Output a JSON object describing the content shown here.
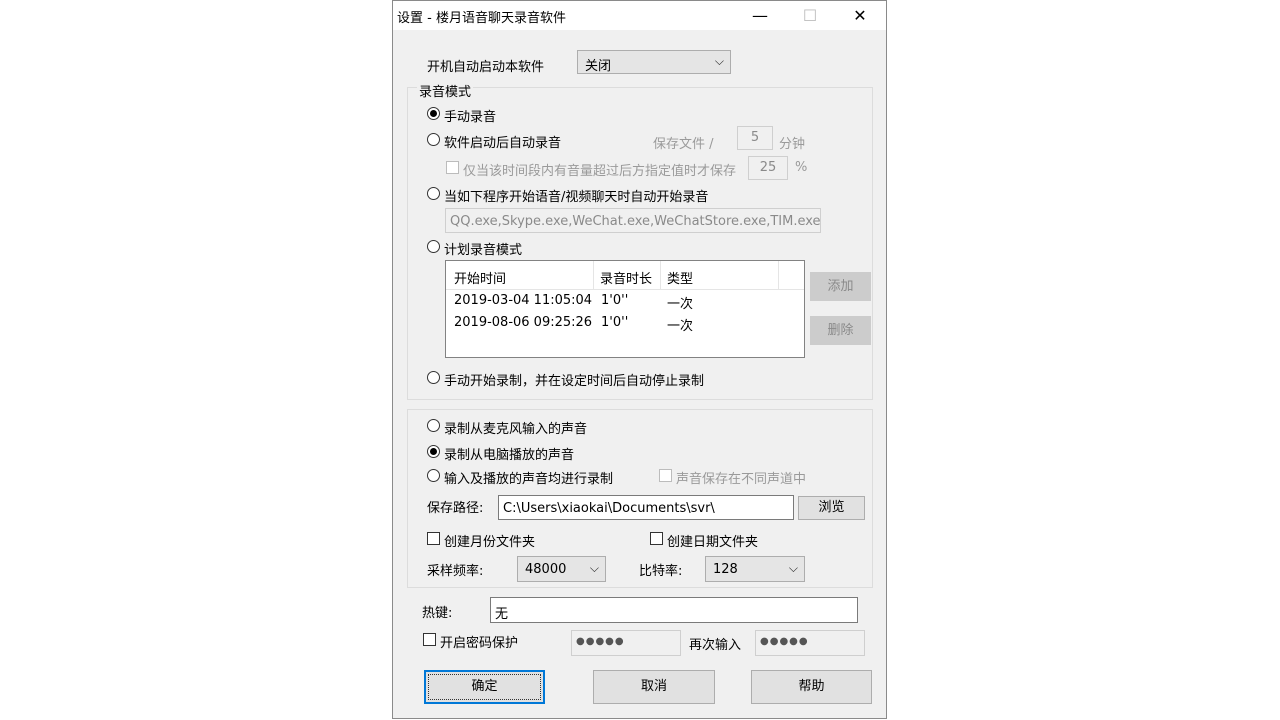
{
  "window": {
    "title": "设置 - 楼月语音聊天录音软件",
    "minimize_icon": "minimize-icon",
    "maximize_icon": "maximize-icon",
    "close_icon": "close-icon"
  },
  "autostart": {
    "label": "开机自动启动本软件",
    "value": "关闭"
  },
  "record_mode": {
    "group_label": "录音模式",
    "manual": "手动录音",
    "auto_after_start": "软件启动后自动录音",
    "save_file_label": "保存文件 /",
    "save_minutes_value": "5",
    "minutes_unit": "分钟",
    "volume_check_label": "仅当该时间段内有音量超过后方指定值时才保存",
    "volume_value": "25",
    "percent_unit": "%",
    "program_mode": "当如下程序开始语音/视频聊天时自动开始录音",
    "programs": "QQ.exe,Skype.exe,WeChat.exe,WeChatStore.exe,TIM.exe",
    "schedule_mode": "计划录音模式",
    "table": {
      "columns": [
        "开始时间",
        "录音时长",
        "类型"
      ],
      "rows": [
        [
          "2019-03-04 11:05:04",
          "1'0''",
          "一次"
        ],
        [
          "2019-08-06 09:25:26",
          "1'0''",
          "一次"
        ]
      ]
    },
    "add_button": "添加",
    "delete_button": "删除",
    "manual_timed": "手动开始录制，并在设定时间后自动停止录制"
  },
  "source": {
    "mic": "录制从麦克风输入的声音",
    "pc": "录制从电脑播放的声音",
    "both": "输入及播放的声音均进行录制",
    "separate_channels": "声音保存在不同声道中",
    "save_path_label": "保存路径:",
    "save_path": "C:\\Users\\xiaokai\\Documents\\svr\\",
    "browse_button": "浏览",
    "month_folder": "创建月份文件夹",
    "date_folder": "创建日期文件夹",
    "sample_rate_label": "采样频率:",
    "sample_rate": "48000",
    "bitrate_label": "比特率:",
    "bitrate": "128"
  },
  "hotkey": {
    "label": "热键:",
    "value": "无"
  },
  "password": {
    "label": "开启密码保护",
    "value": "●●●●●",
    "confirm_label": "再次输入",
    "confirm_value": "●●●●●"
  },
  "buttons": {
    "ok": "确定",
    "cancel": "取消",
    "help": "帮助"
  }
}
